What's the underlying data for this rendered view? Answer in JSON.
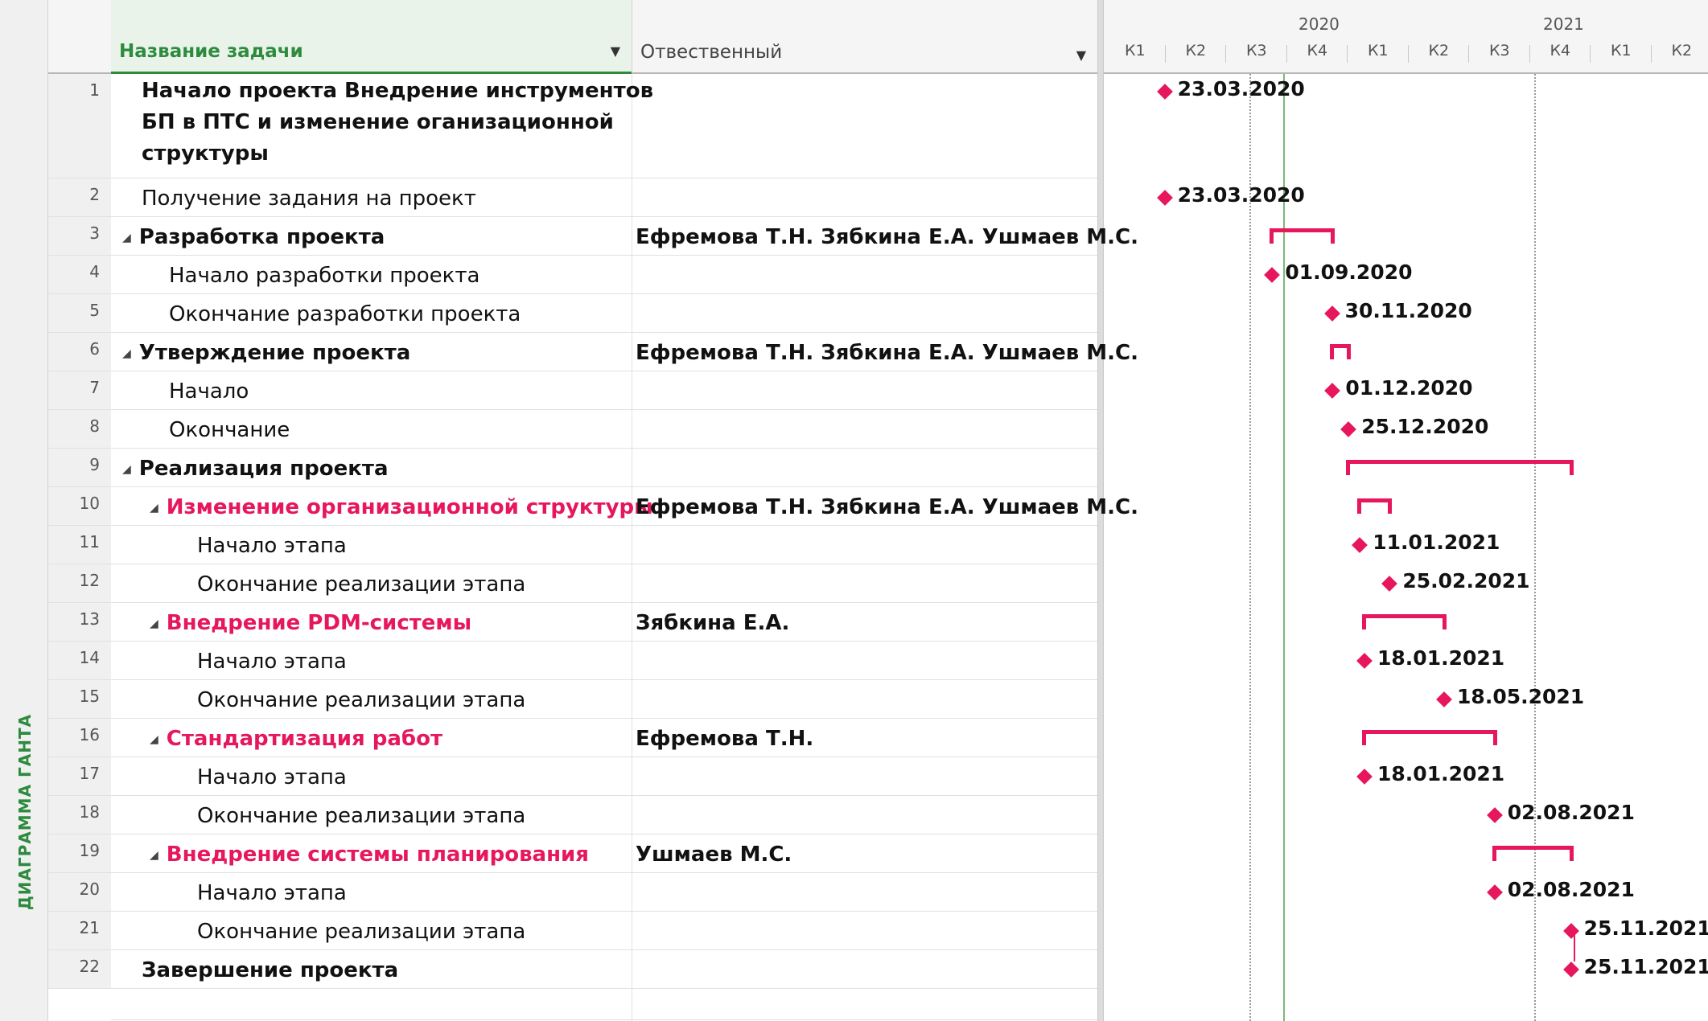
{
  "sidebar": {
    "view_label": "ДИАГРАММА ГАНТА"
  },
  "columns": {
    "name": "Название задачи",
    "responsible": "Отвественный"
  },
  "timescale": {
    "years": [
      "2020",
      "2021"
    ],
    "quarters": [
      "К1",
      "К2",
      "К3",
      "К4",
      "К1",
      "К2",
      "К3",
      "К4",
      "К1",
      "К2"
    ]
  },
  "colors": {
    "accent": "#e6175c",
    "header_green": "#2e8b3e"
  },
  "tasks": [
    {
      "id": "1",
      "name_lines": [
        "Начало проекта Внедрение инструментов",
        "БП в ПТС и изменение оганизационной",
        "структуры"
      ],
      "responsible": "",
      "summary": false,
      "bold": true,
      "indent": 0,
      "milestone": "23.03.2020"
    },
    {
      "id": "2",
      "name": "Получение задания на проект",
      "responsible": "",
      "bold": false,
      "indent": 0,
      "milestone": "23.03.2020"
    },
    {
      "id": "3",
      "name": "Разработка проекта",
      "responsible": "Ефремова Т.Н. Зябкина Е.А. Ушмаев М.С.",
      "bold": true,
      "indent": 0,
      "summary": true
    },
    {
      "id": "4",
      "name": "Начало разработки проекта",
      "responsible": "",
      "bold": false,
      "indent": 1,
      "milestone": "01.09.2020"
    },
    {
      "id": "5",
      "name": "Окончание разработки проекта",
      "responsible": "",
      "bold": false,
      "indent": 1,
      "milestone": "30.11.2020"
    },
    {
      "id": "6",
      "name": "Утверждение проекта",
      "responsible": "Ефремова Т.Н. Зябкина Е.А. Ушмаев М.С.",
      "bold": true,
      "indent": 0,
      "summary": true
    },
    {
      "id": "7",
      "name": "Начало",
      "responsible": "",
      "bold": false,
      "indent": 1,
      "milestone": "01.12.2020"
    },
    {
      "id": "8",
      "name": "Окончание",
      "responsible": "",
      "bold": false,
      "indent": 1,
      "milestone": "25.12.2020"
    },
    {
      "id": "9",
      "name": "Реализация проекта",
      "responsible": "",
      "bold": true,
      "indent": 0,
      "summary": true
    },
    {
      "id": "10",
      "name": "Изменение организационной структуры",
      "responsible": "Ефремова Т.Н. Зябкина Е.А. Ушмаев М.С.",
      "bold": true,
      "indent": 1,
      "summary": true,
      "pink": true
    },
    {
      "id": "11",
      "name": "Начало этапа",
      "responsible": "",
      "bold": false,
      "indent": 2,
      "milestone": "11.01.2021"
    },
    {
      "id": "12",
      "name": "Окончание реализации этапа",
      "responsible": "",
      "bold": false,
      "indent": 2,
      "milestone": "25.02.2021"
    },
    {
      "id": "13",
      "name": "Внедрение PDM-системы",
      "responsible": "Зябкина Е.А.",
      "bold": true,
      "indent": 1,
      "summary": true,
      "pink": true
    },
    {
      "id": "14",
      "name": "Начало этапа",
      "responsible": "",
      "bold": false,
      "indent": 2,
      "milestone": "18.01.2021"
    },
    {
      "id": "15",
      "name": "Окончание реализации этапа",
      "responsible": "",
      "bold": false,
      "indent": 2,
      "milestone": "18.05.2021"
    },
    {
      "id": "16",
      "name": "Стандартизация работ",
      "responsible": "Ефремова Т.Н.",
      "bold": true,
      "indent": 1,
      "summary": true,
      "pink": true
    },
    {
      "id": "17",
      "name": "Начало этапа",
      "responsible": "",
      "bold": false,
      "indent": 2,
      "milestone": "18.01.2021"
    },
    {
      "id": "18",
      "name": "Окончание реализации этапа",
      "responsible": "",
      "bold": false,
      "indent": 2,
      "milestone": "02.08.2021"
    },
    {
      "id": "19",
      "name": "Внедрение системы планирования",
      "responsible": "Ушмаев М.С.",
      "bold": true,
      "indent": 1,
      "summary": true,
      "pink": true
    },
    {
      "id": "20",
      "name": "Начало этапа",
      "responsible": "",
      "bold": false,
      "indent": 2,
      "milestone": "02.08.2021"
    },
    {
      "id": "21",
      "name": "Окончание реализации этапа",
      "responsible": "",
      "bold": false,
      "indent": 2,
      "milestone": "25.11.2021"
    },
    {
      "id": "22",
      "name": "Завершение проекта",
      "responsible": "",
      "bold": true,
      "indent": 0,
      "milestone": "25.11.2021"
    }
  ]
}
